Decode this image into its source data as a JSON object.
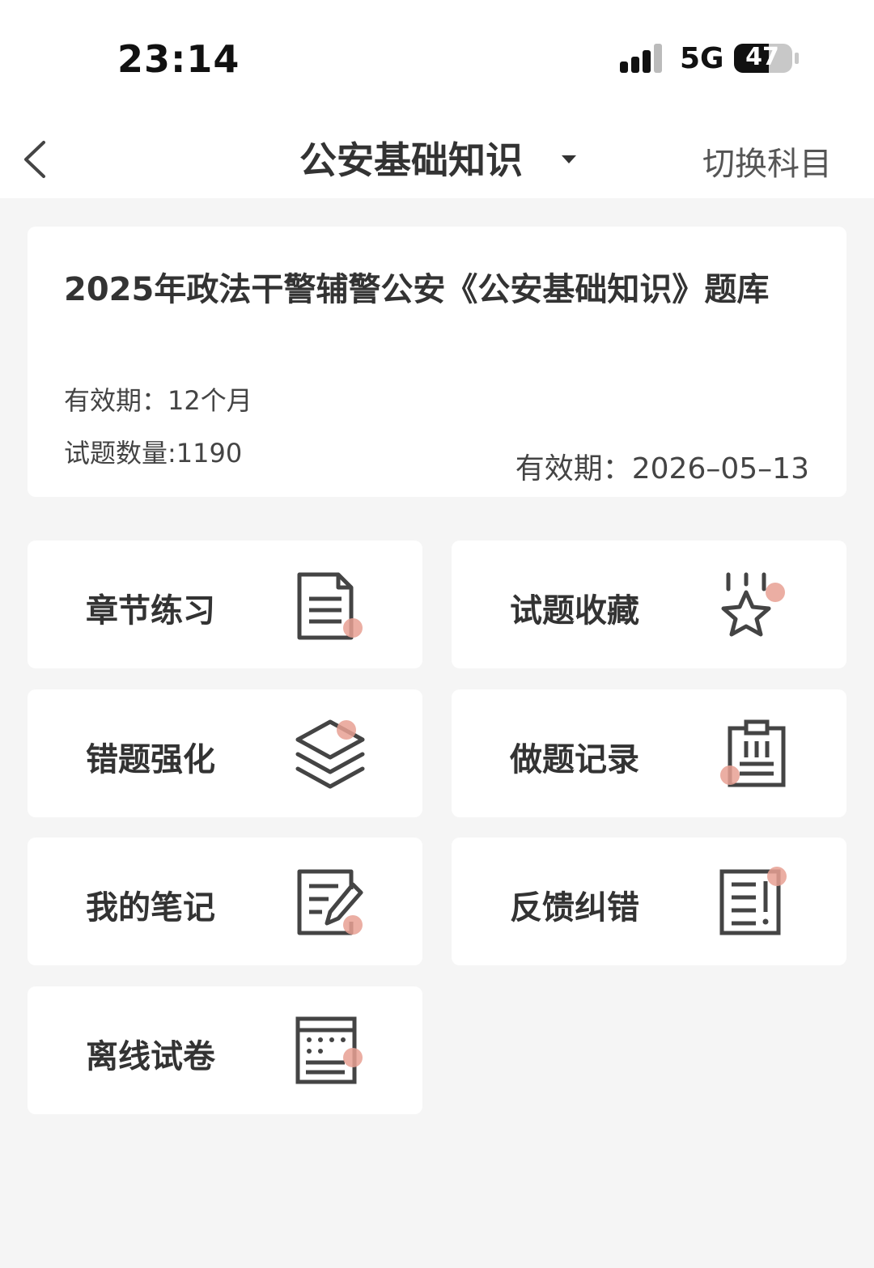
{
  "status_bar": {
    "time": "23:14",
    "network": "5G",
    "battery": "47"
  },
  "navbar": {
    "title": "公安基础知识",
    "switch_label": "切换科目"
  },
  "info": {
    "title": "2025年政法干警辅警公安《公安基础知识》题库",
    "validity": "有效期：12个月",
    "question_count": "试题数量:1190",
    "expiry": "有效期：2026–05–13"
  },
  "menu": {
    "chapter_practice": "章节练习",
    "favorites": "试题收藏",
    "wrong_review": "错题强化",
    "history": "做题记录",
    "notes": "我的笔记",
    "feedback": "反馈纠错",
    "offline_paper": "离线试卷"
  },
  "colors": {
    "accent_dot": "#e8a093",
    "icon_stroke": "#444444",
    "background": "#f5f5f5"
  }
}
